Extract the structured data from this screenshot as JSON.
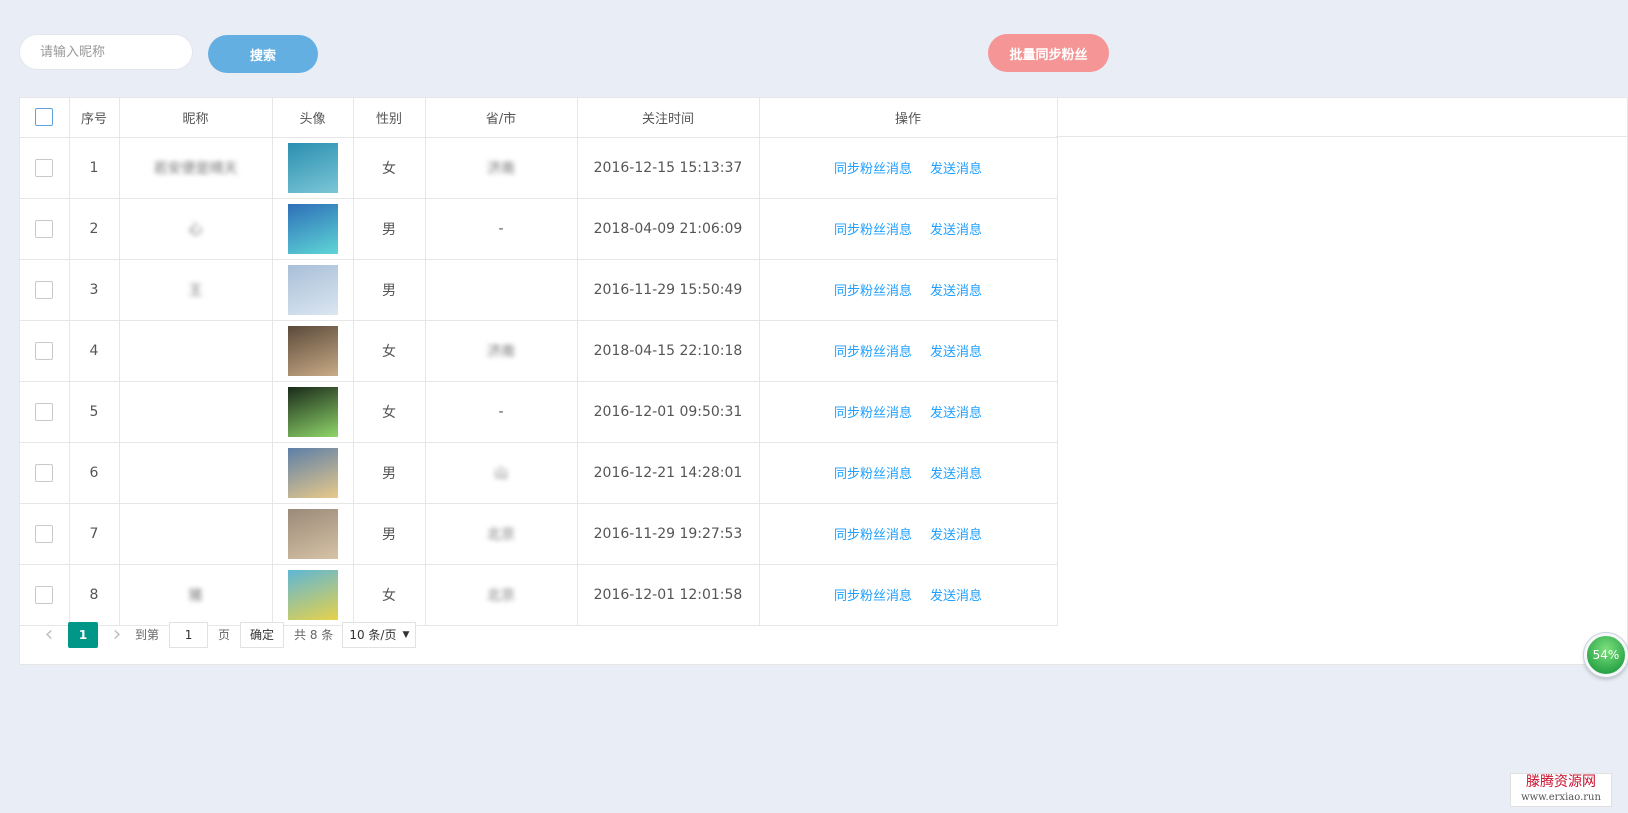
{
  "toolbar": {
    "search_placeholder": "请输入昵称",
    "search_label": "搜索",
    "batch_sync_label": "批量同步粉丝"
  },
  "table": {
    "columns": [
      "序号",
      "昵称",
      "头像",
      "性别",
      "省/市",
      "关注时间",
      "操作"
    ],
    "rows": [
      {
        "index": "1",
        "nickname": "若安便是晴天",
        "gender": "女",
        "region": "济南",
        "follow_time": "2016-12-15 15:13:37",
        "avatar_colors": [
          "#2a8fb0",
          "#7cc6d6"
        ]
      },
      {
        "index": "2",
        "nickname": "心",
        "gender": "男",
        "region": "-",
        "follow_time": "2018-04-09 21:06:09",
        "avatar_colors": [
          "#2d6fb8",
          "#5fd6d6"
        ]
      },
      {
        "index": "3",
        "nickname": "王",
        "gender": "男",
        "region": "",
        "follow_time": "2016-11-29 15:50:49",
        "avatar_colors": [
          "#a8bfd8",
          "#dbe6f0"
        ]
      },
      {
        "index": "4",
        "nickname": "",
        "gender": "女",
        "region": "济南",
        "follow_time": "2018-04-15 22:10:18",
        "avatar_colors": [
          "#5b4a3a",
          "#c9ab86"
        ]
      },
      {
        "index": "5",
        "nickname": "",
        "gender": "女",
        "region": "-",
        "follow_time": "2016-12-01 09:50:31",
        "avatar_colors": [
          "#1a2a1a",
          "#8fd66a"
        ]
      },
      {
        "index": "6",
        "nickname": "",
        "gender": "男",
        "region": "山",
        "follow_time": "2016-12-21 14:28:01",
        "avatar_colors": [
          "#5d7fa8",
          "#e8c98a"
        ]
      },
      {
        "index": "7",
        "nickname": "",
        "gender": "男",
        "region": "北京",
        "follow_time": "2016-11-29 19:27:53",
        "avatar_colors": [
          "#9a8a78",
          "#d6c2a6"
        ]
      },
      {
        "index": "8",
        "nickname": "猪",
        "gender": "女",
        "region": "北京",
        "follow_time": "2016-12-01 12:01:58",
        "avatar_colors": [
          "#5fb6d6",
          "#e6d24a"
        ]
      }
    ],
    "actions": {
      "sync_label": "同步粉丝消息",
      "send_label": "发送消息"
    }
  },
  "pagination": {
    "current_page": "1",
    "goto_label": "到第",
    "goto_value": "1",
    "page_suffix": "页",
    "confirm_label": "确定",
    "total_label": "共 8 条",
    "page_size_label": "10 条/页"
  },
  "progress": {
    "label": "54%",
    "percent": 54
  },
  "watermark": {
    "cn": "滕腾资源网",
    "en": "www.erxiao.run"
  }
}
